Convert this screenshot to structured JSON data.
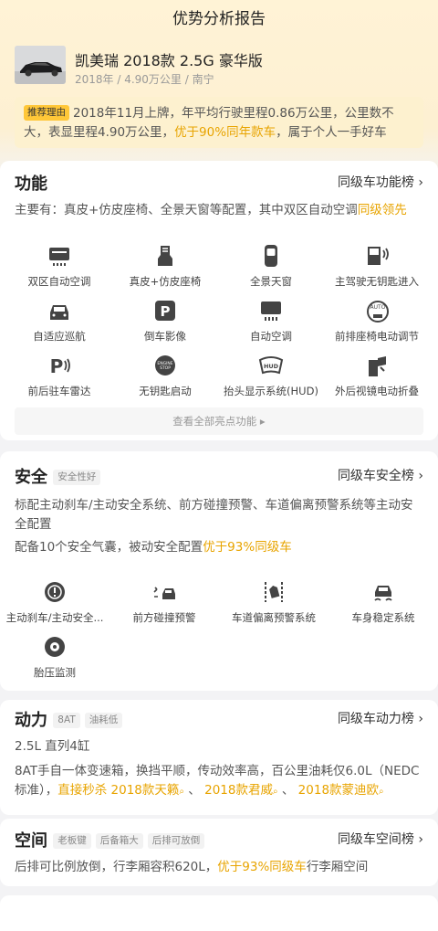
{
  "header": {
    "title": "优势分析报告"
  },
  "car": {
    "name": "凯美瑞 2018款 2.5G 豪华版",
    "meta": "2018年 / 4.90万公里 / 南宁"
  },
  "reason": {
    "tag": "推荐理由",
    "text_a": "2018年11月上牌，年平均行驶里程0.86万公里，公里数不大，表显里程4.90万公里，",
    "text_hl": "优于90%同年款车",
    "text_b": "，属于个人一手好车"
  },
  "function": {
    "title": "功能",
    "link": "同级车功能榜 ›",
    "desc_a": "主要有：真皮+仿皮座椅、全景天窗等配置，其中双区自动空调",
    "desc_hl": "同级领先",
    "items": [
      {
        "label": "双区自动空调",
        "icon": "dual-zone-ac-icon"
      },
      {
        "label": "真皮+仿皮座椅",
        "icon": "leather-seat-icon"
      },
      {
        "label": "全景天窗",
        "icon": "panoramic-sunroof-icon"
      },
      {
        "label": "主驾驶无钥匙进入",
        "icon": "keyless-entry-icon"
      },
      {
        "label": "自适应巡航",
        "icon": "adaptive-cruise-icon"
      },
      {
        "label": "倒车影像",
        "icon": "reverse-camera-icon"
      },
      {
        "label": "自动空调",
        "icon": "auto-ac-icon"
      },
      {
        "label": "前排座椅电动调节",
        "icon": "power-seat-icon"
      },
      {
        "label": "前后驻车雷达",
        "icon": "parking-radar-icon"
      },
      {
        "label": "无钥匙启动",
        "icon": "keyless-start-icon"
      },
      {
        "label": "抬头显示系统(HUD)",
        "icon": "hud-icon"
      },
      {
        "label": "外后视镜电动折叠",
        "icon": "mirror-fold-icon"
      }
    ],
    "view_all": "查看全部亮点功能 ▸"
  },
  "safety": {
    "title": "安全",
    "tags": [
      "安全性好"
    ],
    "link": "同级车安全榜 ›",
    "desc1": "标配主动刹车/主动安全系统、前方碰撞预警、车道偏离预警系统等主动安全配置",
    "desc2_a": "配备10个安全气囊，被动安全配置",
    "desc2_hl": "优于93%同级车",
    "items": [
      {
        "label": "主动刹车/主动安全...",
        "icon": "active-brake-icon"
      },
      {
        "label": "前方碰撞预警",
        "icon": "collision-warning-icon"
      },
      {
        "label": "车道偏离预警系统",
        "icon": "lane-departure-icon"
      },
      {
        "label": "车身稳定系统",
        "icon": "stability-control-icon"
      },
      {
        "label": "胎压监测",
        "icon": "tire-pressure-icon"
      }
    ]
  },
  "power": {
    "title": "动力",
    "tags": [
      "8AT",
      "油耗低"
    ],
    "link": "同级车动力榜 ›",
    "engine": "2.5L 直列4缸",
    "desc_a": "8AT手自一体变速箱，换挡平顺，传动效率高，百公里油耗仅6.0L（NEDC标准），",
    "desc_hl1": "直接秒杀 2018款天籁",
    "sep": " 、 ",
    "desc_hl2": "2018款君威",
    "desc_hl3": "2018款蒙迪欧"
  },
  "space": {
    "title": "空间",
    "tags": [
      "老板键",
      "后备箱大",
      "后排可放倒"
    ],
    "link": "同级车空间榜 ›",
    "desc_a": "后排可比例放倒，行李厢容积620L，",
    "desc_hl": "优于93%同级车",
    "desc_b": "行李厢空间"
  }
}
